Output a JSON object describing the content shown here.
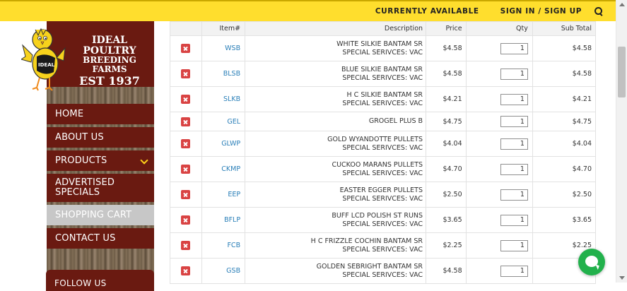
{
  "header": {
    "currently_available": "CURRENTLY AVAILABLE",
    "sign_in": "SIGN IN / SIGN UP",
    "search_icon": "search-icon",
    "bar_color": "#ffde2d"
  },
  "brand": {
    "line1": "IDEAL POULTRY",
    "line2": "BREEDING FARMS",
    "line3": "EST 1937",
    "mascot_badge": "IDEAL",
    "color": "#6a1a11"
  },
  "menu": {
    "home": "HOME",
    "about": "ABOUT US",
    "products": "PRODUCTS",
    "advertised_l1": "ADVERTISED",
    "advertised_l2": "SPECIALS",
    "cart": "SHOPPING CART",
    "contact": "CONTACT US",
    "follow": "FOLLOW US"
  },
  "table": {
    "headers": {
      "item": "Item#",
      "description": "Description",
      "price": "Price",
      "qty": "Qty",
      "subtotal": "Sub Total"
    },
    "rows": [
      {
        "item": "WSB",
        "desc1": "WHITE SILKIE BANTAM SR",
        "desc2": "SPECIAL SERIVCES: VAC",
        "price": "$4.58",
        "qty": "1",
        "subtotal": "$4.58"
      },
      {
        "item": "BLSB",
        "desc1": "BLUE SILKIE BANTAM SR",
        "desc2": "SPECIAL SERIVCES: VAC",
        "price": "$4.58",
        "qty": "1",
        "subtotal": "$4.58"
      },
      {
        "item": "SLKB",
        "desc1": "H C SILKIE BANTAM SR",
        "desc2": "SPECIAL SERIVCES: VAC",
        "price": "$4.21",
        "qty": "1",
        "subtotal": "$4.21"
      },
      {
        "item": "GEL",
        "desc1": "GROGEL PLUS B",
        "desc2": "",
        "price": "$4.75",
        "qty": "1",
        "subtotal": "$4.75"
      },
      {
        "item": "GLWP",
        "desc1": "GOLD WYANDOTTE PULLETS",
        "desc2": "SPECIAL SERIVCES: VAC",
        "price": "$4.04",
        "qty": "1",
        "subtotal": "$4.04"
      },
      {
        "item": "CKMP",
        "desc1": "CUCKOO MARANS PULLETS",
        "desc2": "SPECIAL SERIVCES: VAC",
        "price": "$4.70",
        "qty": "1",
        "subtotal": "$4.70"
      },
      {
        "item": "EEP",
        "desc1": "EASTER EGGER PULLETS",
        "desc2": "SPECIAL SERIVCES: VAC",
        "price": "$2.50",
        "qty": "1",
        "subtotal": "$2.50"
      },
      {
        "item": "BFLP",
        "desc1": "BUFF LCD POLISH ST RUNS",
        "desc2": "SPECIAL SERIVCES: VAC",
        "price": "$3.65",
        "qty": "1",
        "subtotal": "$3.65"
      },
      {
        "item": "FCB",
        "desc1": "H C FRIZZLE COCHIN BANTAM SR",
        "desc2": "SPECIAL SERIVCES: VAC",
        "price": "$2.25",
        "qty": "1",
        "subtotal": "$2.25"
      },
      {
        "item": "GSB",
        "desc1": "GOLDEN SEBRIGHT BANTAM SR",
        "desc2": "SPECIAL SERIVCES: VAC",
        "price": "$4.58",
        "qty": "1",
        "subtotal": "$"
      }
    ]
  },
  "chat": {
    "icon": "chat-bubble-icon",
    "color": "#22b14c"
  }
}
